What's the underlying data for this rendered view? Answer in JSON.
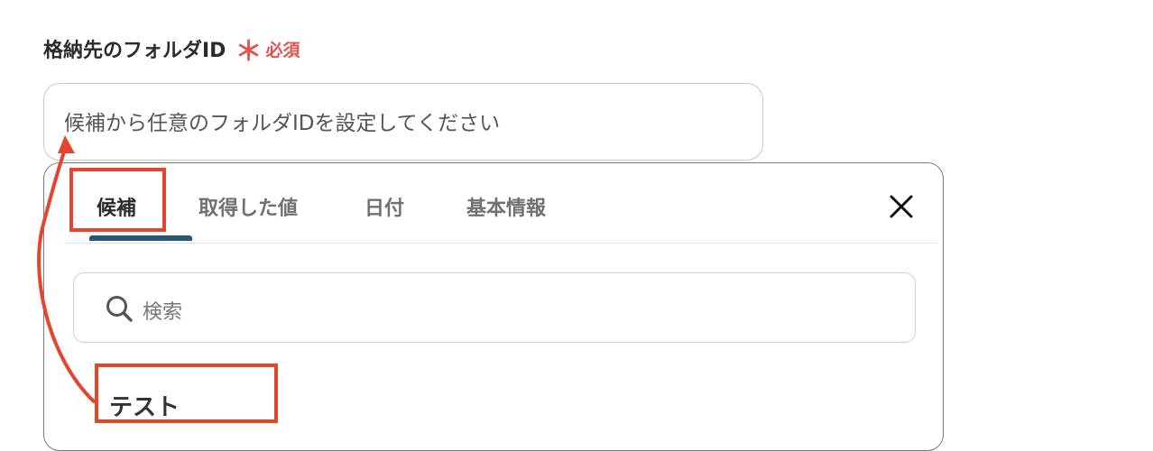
{
  "field": {
    "label": "格納先のフォルダID",
    "required_star": "＊",
    "required_text": "必須",
    "placeholder": "候補から任意のフォルダIDを設定してください"
  },
  "popup": {
    "tabs": [
      {
        "label": "候補",
        "active": true
      },
      {
        "label": "取得した値",
        "active": false
      },
      {
        "label": "日付",
        "active": false
      },
      {
        "label": "基本情報",
        "active": false
      }
    ],
    "close_icon": "close-icon",
    "search": {
      "placeholder": "検索",
      "icon": "search-icon"
    },
    "items": [
      {
        "label": "テスト"
      }
    ]
  },
  "colors": {
    "accent": "#2a5675",
    "required": "#e2534f",
    "annotation": "#e5442f"
  }
}
